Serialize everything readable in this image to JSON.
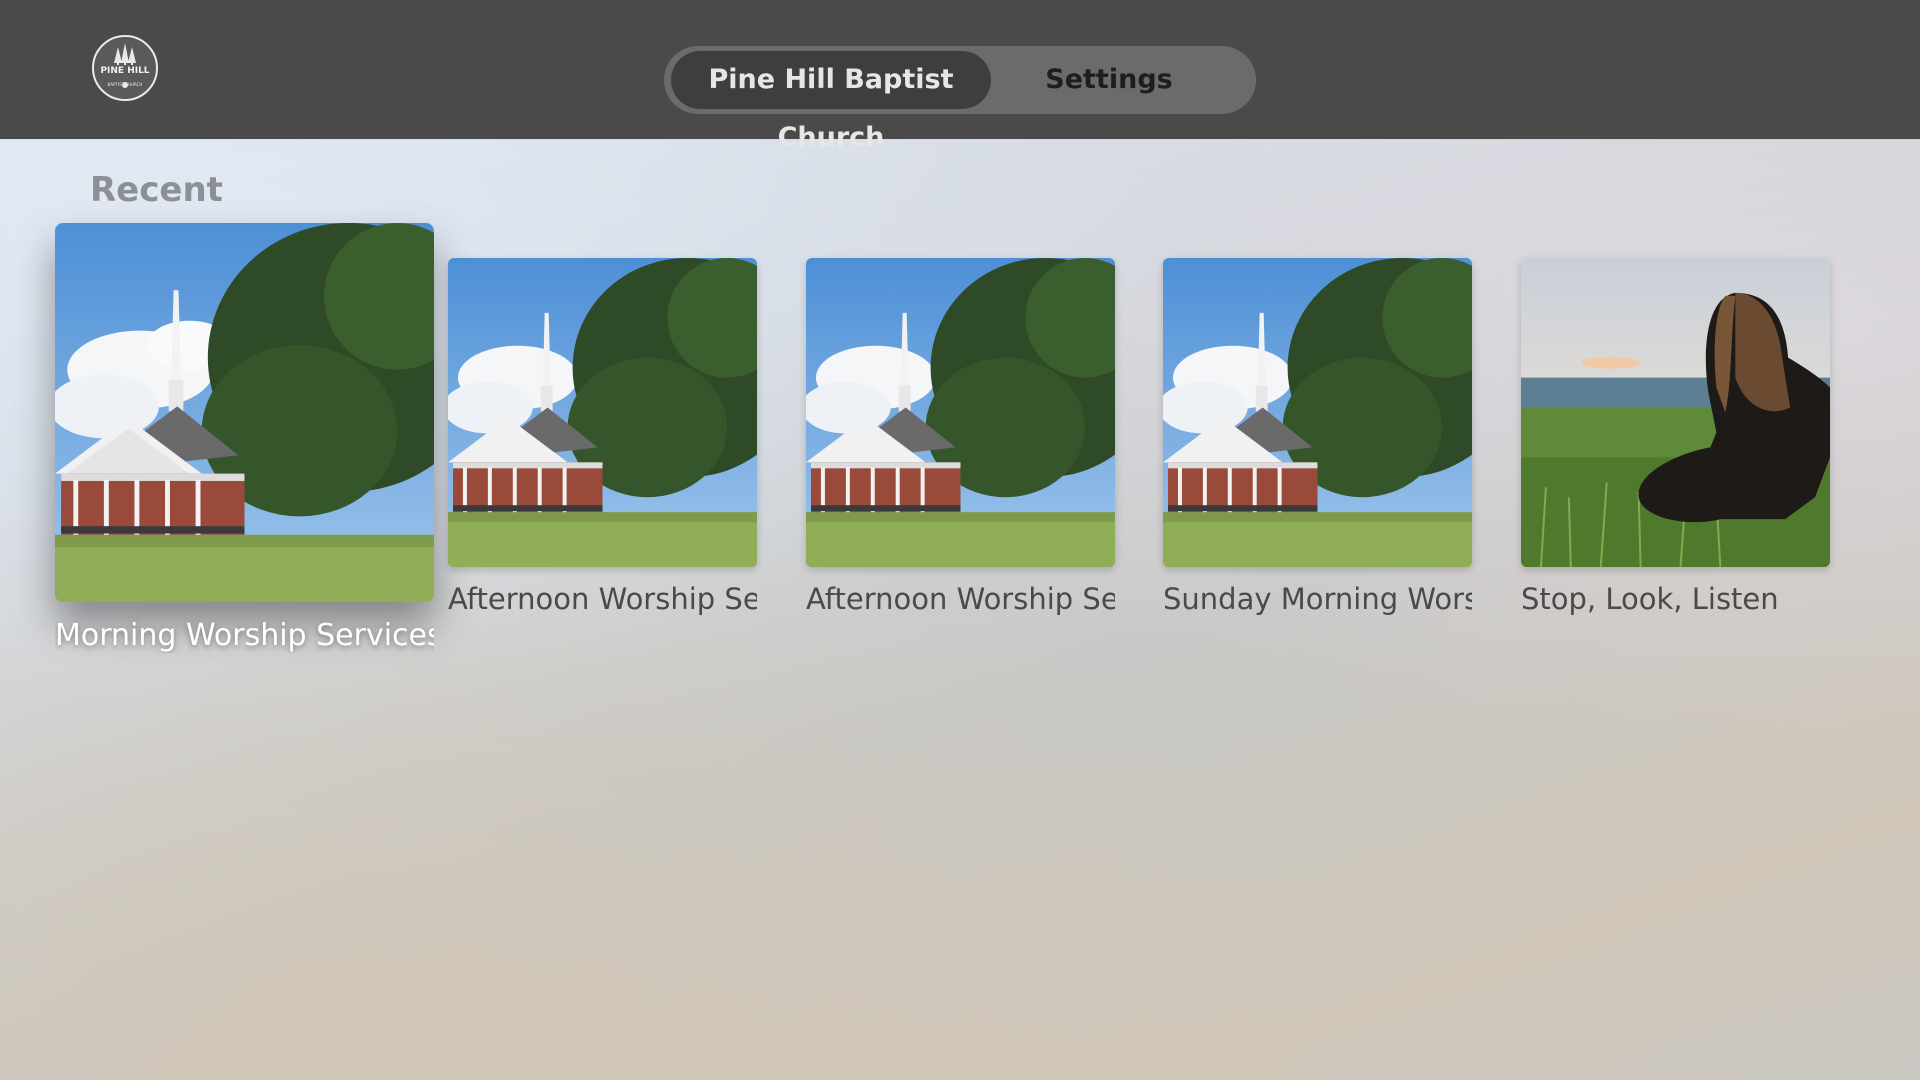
{
  "header": {
    "logo": {
      "text": "PINE HILL",
      "subtext": "BAPTIST CHURCH",
      "icon": "pine-hill-logo-icon"
    },
    "tabs": [
      {
        "label": "Pine Hill Baptist Church",
        "selected": true
      },
      {
        "label": "Settings",
        "selected": false
      }
    ]
  },
  "main": {
    "section_title": "Recent",
    "items": [
      {
        "title": "Morning Worship Services -",
        "image": "church-photo",
        "focused": true
      },
      {
        "title": "Afternoon Worship Ser",
        "image": "church-photo",
        "focused": false
      },
      {
        "title": "Afternoon Worship Ser",
        "image": "church-photo",
        "focused": false
      },
      {
        "title": "Sunday Morning Wors",
        "image": "church-photo",
        "focused": false
      },
      {
        "title": "Stop, Look, Listen",
        "image": "woman-in-field-photo",
        "focused": false
      }
    ]
  },
  "colors": {
    "topbar": "#4a4a4a",
    "selected_tab": "#3e3e3e",
    "segmented_bg": "#6b6b6b"
  }
}
